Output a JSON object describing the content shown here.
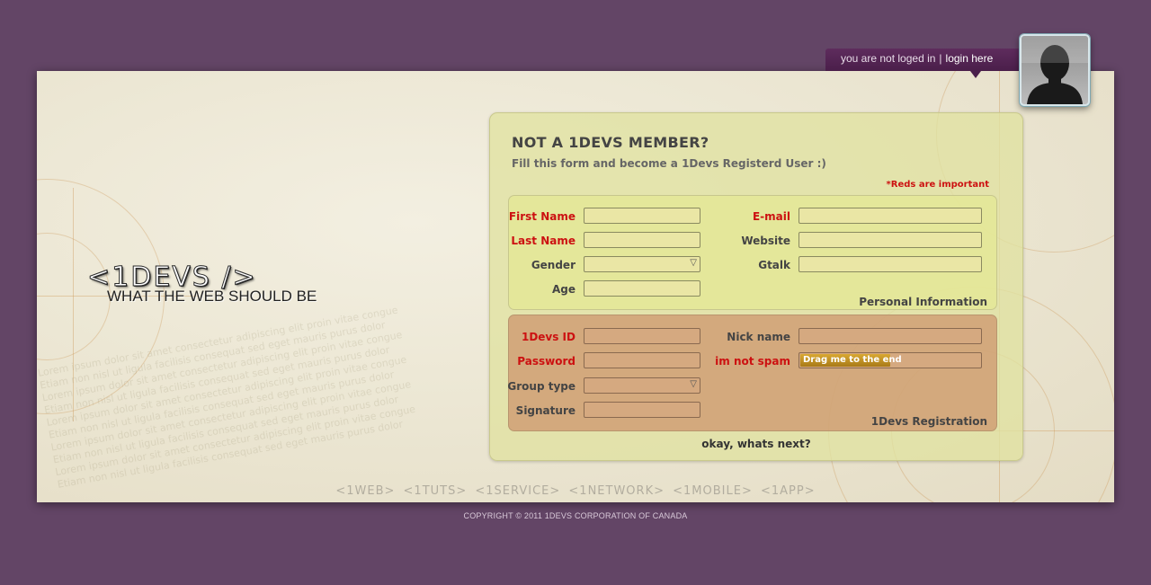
{
  "login": {
    "status": "you are not loged in",
    "separator": "|",
    "link": "login here"
  },
  "logo": {
    "name": "<1DEVS />",
    "tagline": "WHAT THE WEB SHOULD BE"
  },
  "form": {
    "title": "NOT A 1DEVS MEMBER?",
    "subtitle": "Fill this form and become a 1Devs Registerd User :)",
    "required_note": "*Reds are important",
    "personal": {
      "legend": "Personal Information",
      "first_name": "First Name",
      "last_name": "Last Name",
      "gender": "Gender",
      "age": "Age",
      "email": "E-mail",
      "website": "Website",
      "gtalk": "Gtalk"
    },
    "registration": {
      "legend": "1Devs Registration",
      "id": "1Devs ID",
      "password": "Password",
      "group_type": "Group type",
      "signature": "Signature",
      "nick_name": "Nick name",
      "not_spam": "im not spam",
      "slider_label": "Drag me to the end",
      "slider_progress": 0
    },
    "select_arrow": "▽",
    "submit": "okay, whats next?"
  },
  "footer": {
    "nav": [
      "<1WEB>",
      "<1TUTS>",
      "<1SERVICE>",
      "<1NETWORK>",
      "<1MOBILE>",
      "<1APP>"
    ],
    "copyright": "COPYRIGHT © 2011 1DEVS CORPORATION OF CANADA"
  },
  "colors": {
    "background": "#634566",
    "required": "#cc1111",
    "login_bar": "#4a1e4a"
  }
}
